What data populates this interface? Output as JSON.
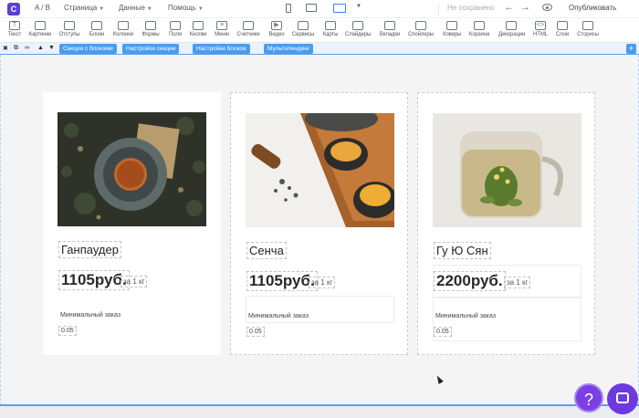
{
  "topbar": {
    "ab": "A / B",
    "menu": [
      "Страница",
      "Данные",
      "Помощь"
    ],
    "status": "Не сохранено",
    "publish": "Опубликовать"
  },
  "tools": [
    "Текст",
    "Картинки",
    "Отступы",
    "Блоки",
    "Колонки",
    "Формы",
    "Поля",
    "Кнопки",
    "Меню",
    "Счетчики",
    "Видео",
    "Сервисы",
    "Карты",
    "Слайдеры",
    "Вкладки",
    "Спойлеры",
    "Ховеры",
    "Корзина",
    "Декорации",
    "HTML",
    "Слои",
    "Сторисы"
  ],
  "section_bar": {
    "sections_with_blocks": "Секции с блоками",
    "section_settings": "Настройки секции",
    "block_settings": "Настройки блоков",
    "multilanding": "Мультилендинг"
  },
  "products": [
    {
      "name": "Ганпаудер",
      "price": "1105руб.",
      "unit": "за 1 кг",
      "min_label": "Минимальный заказ",
      "min_value": "0.05"
    },
    {
      "name": "Сенча",
      "price": "1105руб.",
      "unit": "за 1 кг",
      "min_label": "Минимальный заказ",
      "min_value": "0.05"
    },
    {
      "name": "Гу Ю Сян",
      "price": "2200руб.",
      "unit": "за 1 кг",
      "min_label": "Минимальный заказ",
      "min_value": "0.05"
    }
  ],
  "help_glyph": "?"
}
